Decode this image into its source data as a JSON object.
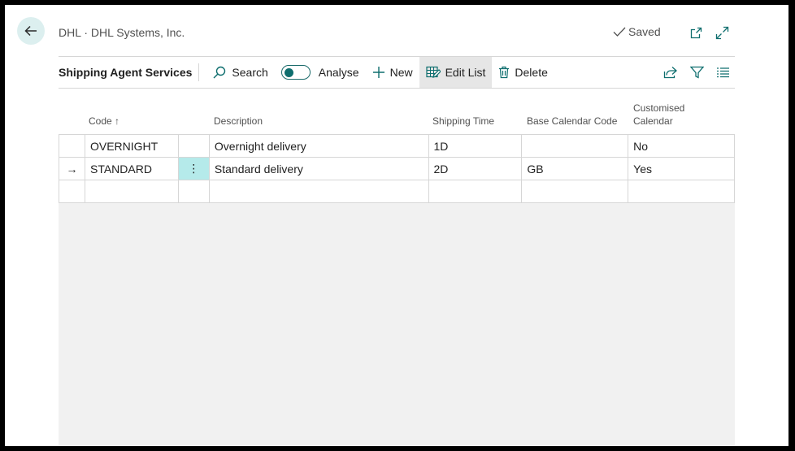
{
  "header": {
    "breadcrumb": "DHL · DHL Systems, Inc.",
    "saved_label": "Saved",
    "icons": [
      "back-arrow-icon",
      "checkmark-icon",
      "open-new-window-icon",
      "expand-icon"
    ]
  },
  "actionbar": {
    "page_title": "Shipping Agent Services",
    "search_label": "Search",
    "analyse_label": "Analyse",
    "new_label": "New",
    "edit_list_label": "Edit List",
    "delete_label": "Delete",
    "icons": [
      "search-icon",
      "toggle",
      "plus-icon",
      "edit-list-icon",
      "trash-icon",
      "share-icon",
      "filter-icon",
      "list-view-icon"
    ]
  },
  "table": {
    "headers": {
      "code": "Code",
      "code_sort": "↑",
      "description": "Description",
      "shipping_time": "Shipping Time",
      "base_calendar_code": "Base Calendar Code",
      "customised_calendar_1": "Customised",
      "customised_calendar_2": "Calendar"
    },
    "rows": [
      {
        "indicator": "",
        "code": "OVERNIGHT",
        "menu": "",
        "description": "Overnight delivery",
        "shipping_time": "1D",
        "base_calendar_code": "",
        "customised_calendar": "No"
      },
      {
        "indicator": "→",
        "code": "STANDARD",
        "menu": "⋮",
        "description": "Standard delivery",
        "shipping_time": "2D",
        "base_calendar_code": "GB",
        "customised_calendar": "Yes"
      },
      {
        "indicator": "",
        "code": "",
        "menu": "",
        "description": "",
        "shipping_time": "",
        "base_calendar_code": "",
        "customised_calendar": ""
      }
    ]
  },
  "colors": {
    "accent": "#0e6e6e",
    "selected_cell": "#b5eaea",
    "back_button_bg": "#dcefef",
    "grid_bg": "#f1f1f1"
  }
}
